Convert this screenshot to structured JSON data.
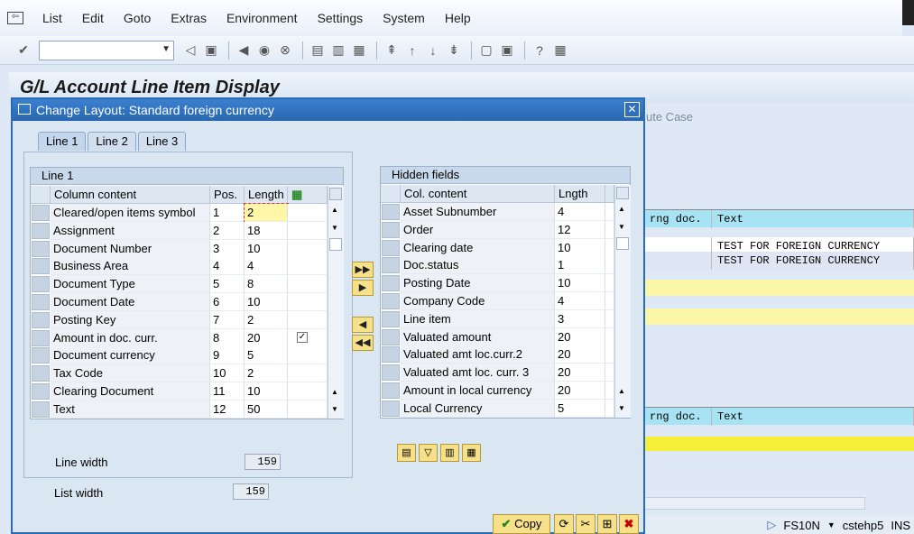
{
  "menu": [
    "List",
    "Edit",
    "Goto",
    "Extras",
    "Environment",
    "Settings",
    "System",
    "Help"
  ],
  "page_title": "G/L Account Line Item Display",
  "background": {
    "partial_button": "ute Case",
    "row1": [
      "rng doc.",
      "Text"
    ],
    "row2": [
      "",
      "TEST FOR FOREIGN CURRENCY"
    ],
    "row3": [
      "",
      "TEST FOR FOREIGN CURRENCY"
    ],
    "row4": [
      "rng doc.",
      "Text"
    ]
  },
  "status": {
    "transaction": "FS10N",
    "server": "cstehp5",
    "mode": "INS"
  },
  "dialog": {
    "title": "Change Layout: Standard foreign currency",
    "tabs": [
      "Line 1",
      "Line 2",
      "Line 3"
    ],
    "left_table": {
      "caption": "Line 1",
      "headers": [
        "Column content",
        "Pos.",
        "Length"
      ],
      "rows": [
        {
          "name": "Cleared/open items symbol",
          "pos": "1",
          "len": "2",
          "check": false
        },
        {
          "name": "Assignment",
          "pos": "2",
          "len": "18",
          "check": false
        },
        {
          "name": "Document Number",
          "pos": "3",
          "len": "10",
          "check": false
        },
        {
          "name": "Business Area",
          "pos": "4",
          "len": "4",
          "check": false
        },
        {
          "name": "Document Type",
          "pos": "5",
          "len": "8",
          "check": false
        },
        {
          "name": "Document Date",
          "pos": "6",
          "len": "10",
          "check": false
        },
        {
          "name": "Posting Key",
          "pos": "7",
          "len": "2",
          "check": false
        },
        {
          "name": "Amount in doc. curr.",
          "pos": "8",
          "len": "20",
          "check": true
        },
        {
          "name": "Document currency",
          "pos": "9",
          "len": "5",
          "check": false
        },
        {
          "name": "Tax Code",
          "pos": "10",
          "len": "2",
          "check": false
        },
        {
          "name": "Clearing Document",
          "pos": "11",
          "len": "10",
          "check": false
        },
        {
          "name": "Text",
          "pos": "12",
          "len": "50",
          "check": false
        }
      ]
    },
    "right_table": {
      "caption": "Hidden fields",
      "headers": [
        "Col. content",
        "Lngth"
      ],
      "rows": [
        {
          "name": "Asset Subnumber",
          "len": "4"
        },
        {
          "name": "Order",
          "len": "12"
        },
        {
          "name": "Clearing date",
          "len": "10"
        },
        {
          "name": "Doc.status",
          "len": "1"
        },
        {
          "name": "Posting Date",
          "len": "10"
        },
        {
          "name": "Company Code",
          "len": "4"
        },
        {
          "name": "Line item",
          "len": "3"
        },
        {
          "name": "Valuated amount",
          "len": "20"
        },
        {
          "name": "Valuated amt loc.curr.2",
          "len": "20"
        },
        {
          "name": "Valuated amt loc. curr. 3",
          "len": "20"
        },
        {
          "name": "Amount in local currency",
          "len": "20"
        },
        {
          "name": "Local Currency",
          "len": "5"
        }
      ]
    },
    "line_width_label": "Line width",
    "line_width": "159",
    "list_width_label": "List width",
    "list_width": "159",
    "copy_label": "Copy"
  }
}
